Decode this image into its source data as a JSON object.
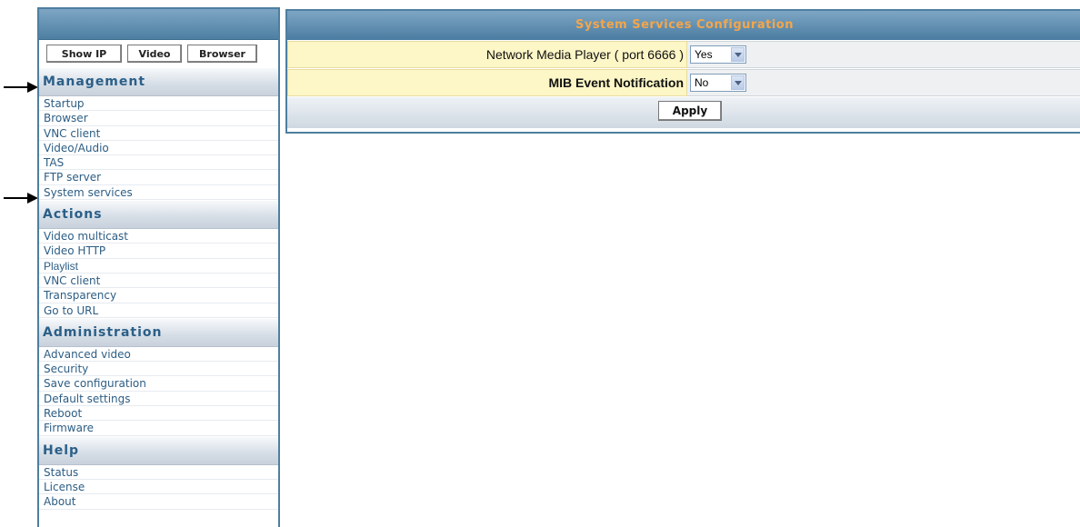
{
  "sidebar": {
    "buttons": {
      "show_ip": "Show IP",
      "video": "Video",
      "browser": "Browser"
    },
    "sections": [
      {
        "title": "Management",
        "items": [
          "Startup",
          "Browser",
          "VNC client",
          "Video/Audio",
          "TAS",
          "FTP server",
          "System services"
        ]
      },
      {
        "title": "Actions",
        "items": [
          "Video multicast",
          "Video HTTP",
          "Playlist",
          "VNC client",
          "Transparency",
          "Go to URL"
        ]
      },
      {
        "title": "Administration",
        "items": [
          "Advanced video",
          "Security",
          "Save configuration",
          "Default settings",
          "Reboot",
          "Firmware"
        ]
      },
      {
        "title": "Help",
        "items": [
          "Status",
          "License",
          "About"
        ]
      }
    ]
  },
  "main": {
    "title": "System Services Configuration",
    "rows": [
      {
        "label": "Network Media Player ( port 6666 )",
        "value": "Yes"
      },
      {
        "label": "MIB Event Notification",
        "value": "No"
      }
    ],
    "apply_label": "Apply"
  },
  "annotations": {
    "arrows": [
      "arrow-icon",
      "arrow-icon"
    ]
  }
}
